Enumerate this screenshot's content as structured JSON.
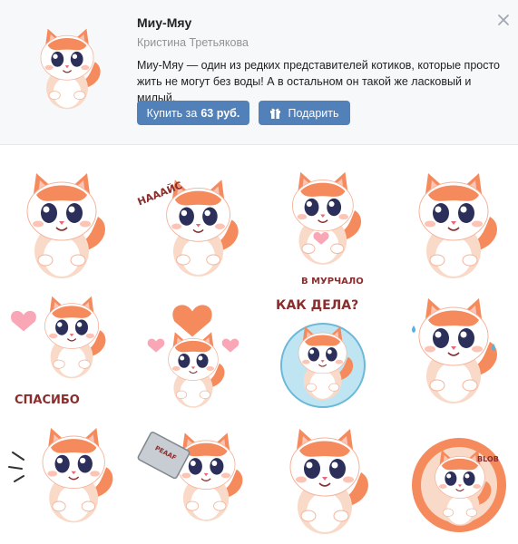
{
  "pack": {
    "title": "Миу-Мяу",
    "author": "Кристина Третьякова",
    "description": "Миу-Мяу — один из редких представителей котиков, которые просто жить не могут без воды! А в остальном он такой же ласковый и милый.",
    "buy_prefix": "Купить за",
    "price": "63 руб.",
    "gift_label": "Подарить"
  },
  "icons": {
    "close": "close-icon",
    "gift": "gift-icon"
  },
  "colors": {
    "accent": "#5181b8",
    "header_bg": "#f7f8fa",
    "cat_orange": "#f58a5d",
    "cat_pink": "#f06f8f",
    "text_dark": "#8a2d2d"
  },
  "stickers": [
    {
      "name": "sticker-happy-cat"
    },
    {
      "name": "sticker-haaais",
      "caption": "НАААЙС"
    },
    {
      "name": "sticker-v-murchalo",
      "caption": "В МУРЧАЛО"
    },
    {
      "name": "sticker-smug-cat"
    },
    {
      "name": "sticker-spasibo",
      "caption": "СПАСИБО"
    },
    {
      "name": "sticker-hearts-cat"
    },
    {
      "name": "sticker-kak-dela",
      "caption": "КАК ДЕЛА?"
    },
    {
      "name": "sticker-crying-cat"
    },
    {
      "name": "sticker-surprised-cat"
    },
    {
      "name": "sticker-laptop-cat",
      "caption": "PEAAF"
    },
    {
      "name": "sticker-shrug-cat"
    },
    {
      "name": "sticker-blob-cat",
      "caption": "BLOB"
    }
  ]
}
